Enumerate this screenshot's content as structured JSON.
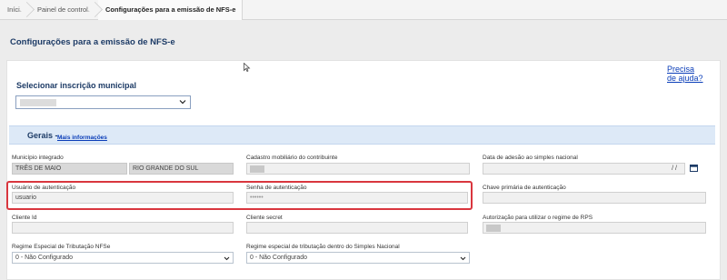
{
  "breadcrumb": {
    "items": [
      "Início",
      "Painel de controle",
      "Configurações para a emissão de NFS-e"
    ]
  },
  "page": {
    "title": "Configurações para a emissão de NFS-e",
    "help_link": "Precisa de ajuda?"
  },
  "selector": {
    "label": "Selecionar inscrição municipal"
  },
  "section": {
    "title": "Gerais -",
    "more_link": "Mais informações"
  },
  "fields": {
    "municipio_label": "Município integrado",
    "municipio_value": "TRÊS DE MAIO",
    "estado_value": "RIO GRANDE DO SUL",
    "cadastro_label": "Cadastro mobiliário do contribuinte",
    "data_adesao_label": "Data de adesão ao simples nacional",
    "data_adesao_value": "/ /",
    "usuario_label": "Usuário de autenticação",
    "usuario_value": "usuario",
    "senha_label": "Senha de autenticação",
    "senha_value": "••••••",
    "chave_label": "Chave primária de autenticação",
    "cliente_id_label": "Cliente Id",
    "cliente_secret_label": "Cliente secret",
    "autorizacao_label": "Autorização para utilizar o regime de RPS",
    "regime_nfse_label": "Regime Especial de Tributação NFSe",
    "regime_nfse_value": "0 - Não Configurado",
    "regime_simples_label": "Regime especial de tributação dentro do Simples Nacional",
    "regime_simples_value": "0 - Não Configurado"
  },
  "icons": {
    "calendar": "calendar-icon",
    "chevron": "chevron-down-icon",
    "cursor": "mouse-cursor-icon"
  },
  "colors": {
    "title_blue": "#1d3b66",
    "link_blue": "#0a3db8",
    "highlight_red": "#d9363e",
    "section_bg": "#dde9f7"
  }
}
